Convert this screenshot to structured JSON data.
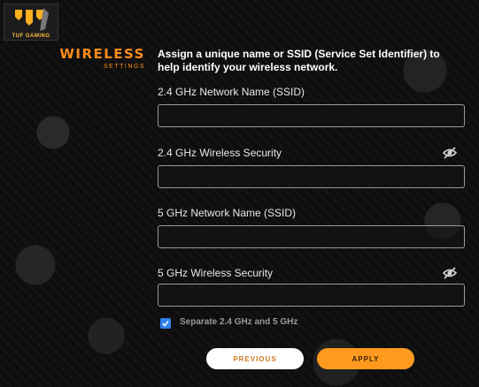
{
  "logo": {
    "text": "TUF GAMING"
  },
  "section": {
    "title": "WIRELESS",
    "subtitle": "SETTINGS"
  },
  "intro": "Assign a unique name or SSID (Service Set Identifier) to help identify your wireless network.",
  "fields": [
    {
      "label": "2.4 GHz Network Name (SSID)",
      "value": "",
      "has_eye": false
    },
    {
      "label": "2.4 GHz Wireless Security",
      "value": "",
      "has_eye": true
    },
    {
      "label": "5 GHz Network Name (SSID)",
      "value": "",
      "has_eye": false
    },
    {
      "label": "5 GHz Wireless Security",
      "value": "",
      "has_eye": true
    }
  ],
  "separate": {
    "label": "Separate 2.4 GHz and 5 GHz",
    "checked": true
  },
  "buttons": {
    "previous": "PREVIOUS",
    "apply": "APPLY"
  },
  "colors": {
    "accent": "#ff9a1f",
    "checkbox": "#2f80ed",
    "background": "#0e0e0e"
  },
  "icons": {
    "logo": "tuf-gaming-logo",
    "eye": "eye-hidden-icon",
    "check": "check-icon"
  }
}
